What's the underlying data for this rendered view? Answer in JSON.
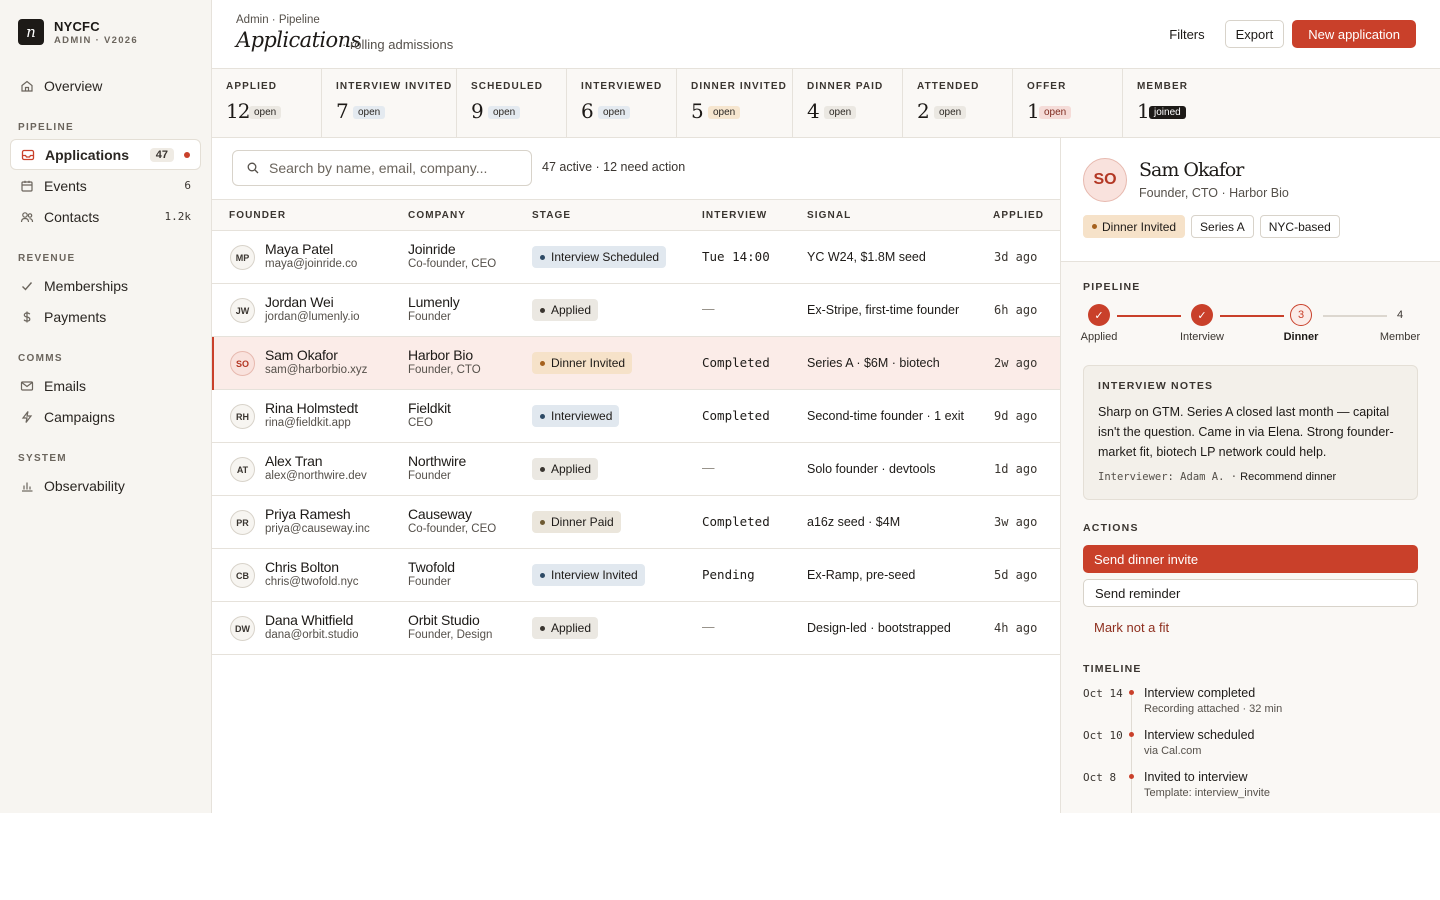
{
  "brand": {
    "name": "NYCFC",
    "sub": "ADMIN · V2026",
    "logo_glyph": "n"
  },
  "sidebar": {
    "overview": "Overview",
    "sections": {
      "pipeline": "PIPELINE",
      "revenue": "REVENUE",
      "comms": "COMMS",
      "system": "SYSTEM"
    },
    "applications": {
      "label": "Applications",
      "count": "47"
    },
    "events": {
      "label": "Events",
      "count": "6"
    },
    "contacts": {
      "label": "Contacts",
      "count": "1.2k"
    },
    "memberships": "Memberships",
    "payments": "Payments",
    "emails": "Emails",
    "campaigns": "Campaigns",
    "observability": "Observability"
  },
  "header": {
    "breadcrumb": "Admin · Pipeline",
    "title": "Applications",
    "subtitle": "· rolling admissions",
    "filters": "Filters",
    "export": "Export",
    "new_application": "New application"
  },
  "stages": [
    {
      "name": "APPLIED",
      "count": "12",
      "tag": "open"
    },
    {
      "name": "INTERVIEW INVITED",
      "count": "7",
      "tag": "open"
    },
    {
      "name": "SCHEDULED",
      "count": "9",
      "tag": "open"
    },
    {
      "name": "INTERVIEWED",
      "count": "6",
      "tag": "open"
    },
    {
      "name": "DINNER INVITED",
      "count": "5",
      "tag": "open"
    },
    {
      "name": "DINNER PAID",
      "count": "4",
      "tag": "open"
    },
    {
      "name": "ATTENDED",
      "count": "2",
      "tag": "open"
    },
    {
      "name": "OFFER",
      "count": "1",
      "tag": "open"
    },
    {
      "name": "MEMBER",
      "count": "1",
      "tag": "joined"
    }
  ],
  "search": {
    "placeholder": "Search by name, email, company...",
    "value": ""
  },
  "list_summary": "47 active · 12 need action",
  "table": {
    "columns": [
      "FOUNDER",
      "COMPANY",
      "STAGE",
      "INTERVIEW",
      "SIGNAL",
      "APPLIED"
    ],
    "rows": [
      {
        "initials": "MP",
        "name": "Maya Patel",
        "email": "maya@joinride.co",
        "company": "Joinride",
        "role": "Co-founder, CEO",
        "stage": "Interview Scheduled",
        "interview": "Tue 14:00",
        "signal": "YC W24, $1.8M seed",
        "applied": "3d ago"
      },
      {
        "initials": "JW",
        "name": "Jordan Wei",
        "email": "jordan@lumenly.io",
        "company": "Lumenly",
        "role": "Founder",
        "stage": "Applied",
        "interview": "—",
        "signal": "Ex-Stripe, first-time founder",
        "applied": "6h ago"
      },
      {
        "initials": "SO",
        "name": "Sam Okafor",
        "email": "sam@harborbio.xyz",
        "company": "Harbor Bio",
        "role": "Founder, CTO",
        "stage": "Dinner Invited",
        "interview": "Completed",
        "signal": "Series A · $6M · biotech",
        "applied": "2w ago"
      },
      {
        "initials": "RH",
        "name": "Rina Holmstedt",
        "email": "rina@fieldkit.app",
        "company": "Fieldkit",
        "role": "CEO",
        "stage": "Interviewed",
        "interview": "Completed",
        "signal": "Second-time founder · 1 exit",
        "applied": "9d ago"
      },
      {
        "initials": "AT",
        "name": "Alex Tran",
        "email": "alex@northwire.dev",
        "company": "Northwire",
        "role": "Founder",
        "stage": "Applied",
        "interview": "—",
        "signal": "Solo founder · devtools",
        "applied": "1d ago"
      },
      {
        "initials": "PR",
        "name": "Priya Ramesh",
        "email": "priya@causeway.inc",
        "company": "Causeway",
        "role": "Co-founder, CEO",
        "stage": "Dinner Paid",
        "interview": "Completed",
        "signal": "a16z seed · $4M",
        "applied": "3w ago"
      },
      {
        "initials": "CB",
        "name": "Chris Bolton",
        "email": "chris@twofold.nyc",
        "company": "Twofold",
        "role": "Founder",
        "stage": "Interview Invited",
        "interview": "Pending",
        "signal": "Ex-Ramp, pre-seed",
        "applied": "5d ago"
      },
      {
        "initials": "DW",
        "name": "Dana Whitfield",
        "email": "dana@orbit.studio",
        "company": "Orbit Studio",
        "role": "Founder, Design",
        "stage": "Applied",
        "interview": "—",
        "signal": "Design-led · bootstrapped",
        "applied": "4h ago"
      }
    ]
  },
  "detail": {
    "initials": "SO",
    "name": "Sam Okafor",
    "role": "Founder, CTO · Harbor Bio",
    "tags": [
      "Dinner Invited",
      "Series A",
      "NYC-based"
    ],
    "pipeline_label": "PIPELINE",
    "pipeline": [
      {
        "label": "Applied",
        "state": "done",
        "marker": "✓"
      },
      {
        "label": "Interview",
        "state": "done",
        "marker": "✓"
      },
      {
        "label": "Dinner",
        "state": "current",
        "marker": "3"
      },
      {
        "label": "Member",
        "state": "todo",
        "marker": "4"
      }
    ],
    "notes": {
      "title": "INTERVIEW NOTES",
      "body": "Sharp on GTM. Series A closed last month — capital isn't the question. Came in via Elena. Strong founder-market fit, biotech LP network could help.",
      "interviewer": "Interviewer: Adam A. ·",
      "recommendation": "Recommend dinner"
    },
    "actions_label": "ACTIONS",
    "actions": {
      "primary": "Send dinner invite",
      "secondary": "Send reminder",
      "tertiary": "Mark not a fit"
    },
    "timeline_label": "TIMELINE",
    "timeline": [
      {
        "date": "Oct 14",
        "title": "Interview completed",
        "sub": "Recording attached · 32 min"
      },
      {
        "date": "Oct 10",
        "title": "Interview scheduled",
        "sub": "via Cal.com"
      },
      {
        "date": "Oct 8",
        "title": "Invited to interview",
        "sub": "Template: interview_invite"
      }
    ]
  },
  "colors": {
    "accent": "#c9402a",
    "sidebar_bg": "#f7f5f1",
    "selected_row": "#fbece8"
  }
}
